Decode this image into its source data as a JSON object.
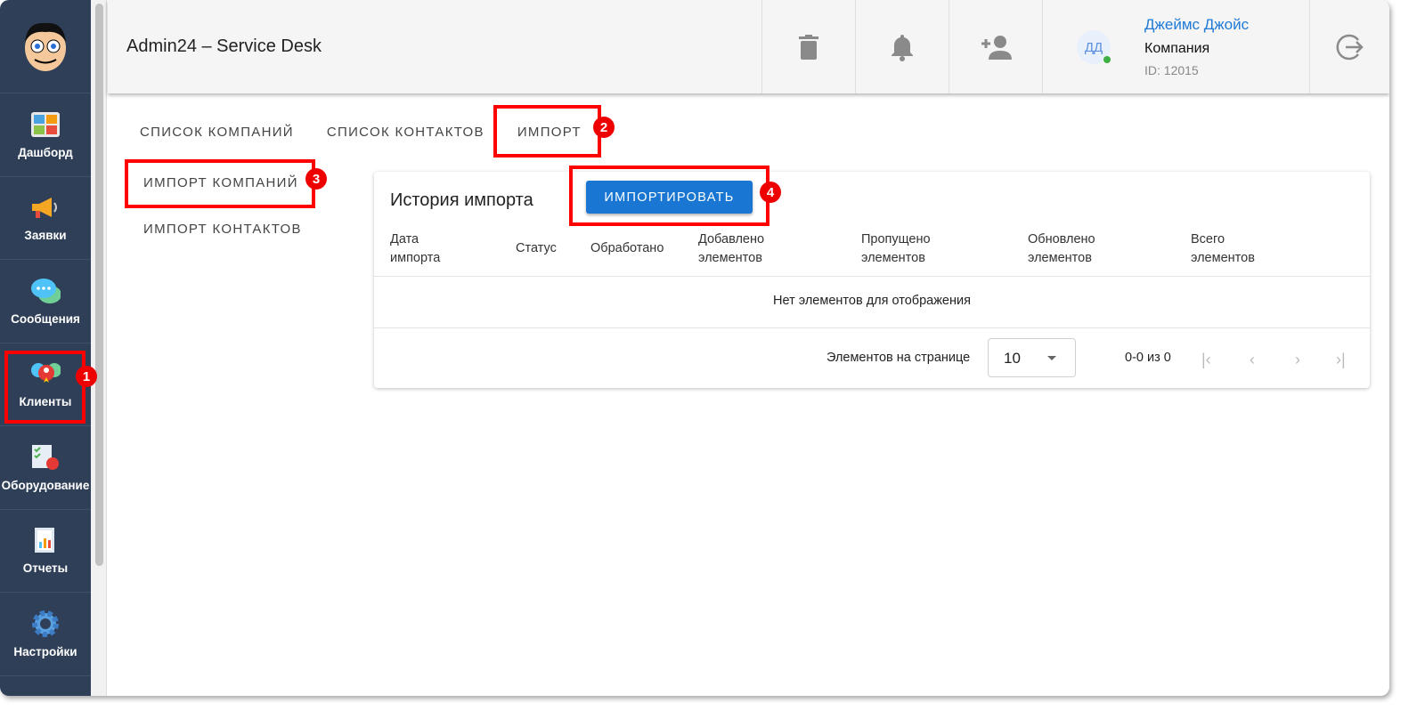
{
  "app": {
    "title": "Admin24 – Service Desk"
  },
  "sidebar": {
    "items": [
      {
        "label": "Дашборд",
        "icon": "dashboard-icon"
      },
      {
        "label": "Заявки",
        "icon": "megaphone-icon"
      },
      {
        "label": "Сообщения",
        "icon": "chat-icon"
      },
      {
        "label": "Клиенты",
        "icon": "clients-icon"
      },
      {
        "label": "Оборудование",
        "icon": "equipment-icon"
      },
      {
        "label": "Отчеты",
        "icon": "report-icon"
      },
      {
        "label": "Настройки",
        "icon": "gear-icon"
      }
    ]
  },
  "header": {
    "user_name": "Джеймс Джойс",
    "company": "Компания",
    "user_id": "ID: 12015",
    "avatar_initials": "ДД"
  },
  "tabs": [
    "СПИСОК КОМПАНИЙ",
    "СПИСОК КОНТАКТОВ",
    "ИМПОРТ"
  ],
  "subtabs": [
    "ИМПОРТ КОМПАНИЙ",
    "ИМПОРТ КОНТАКТОВ"
  ],
  "card": {
    "title": "История импорта",
    "import_button": "ИМПОРТИРОВАТЬ",
    "columns": [
      "Дата\nимпорта",
      "Статус",
      "Обработано",
      "Добавлено\nэлементов",
      "Пропущено\nэлементов",
      "Обновлено\nэлементов",
      "Всего\nэлементов"
    ],
    "empty": "Нет элементов для отображения",
    "per_page_label": "Элементов на странице",
    "per_page_value": "10",
    "range": "0-0 из 0"
  },
  "annotations": [
    "1",
    "2",
    "3",
    "4"
  ],
  "colors": {
    "sidebar": "#2e3f57",
    "accent": "#1976d2",
    "annotation": "#ff0000"
  }
}
